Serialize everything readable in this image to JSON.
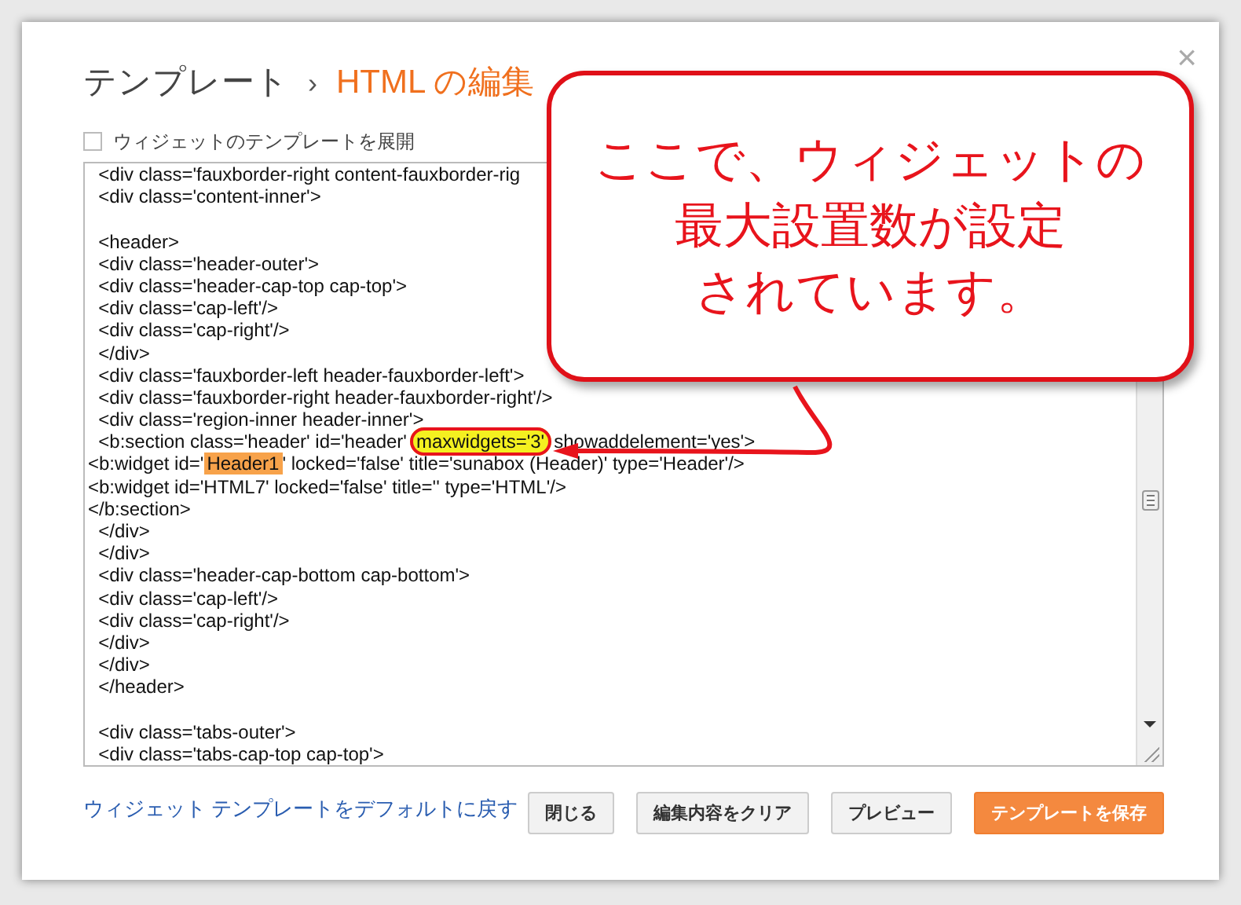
{
  "dialog": {
    "breadcrumb": [
      {
        "label": "テンプレート",
        "current": false
      },
      {
        "label": "HTML の編集",
        "current": true
      }
    ],
    "separator": "›",
    "close": "×",
    "expand_option": {
      "label": "ウィジェットのテンプレートを展開",
      "checked": false
    },
    "code_lines": [
      {
        "segments": [
          {
            "text": "  <div class='fauxborder-right content-fauxborder-rig"
          }
        ]
      },
      {
        "segments": [
          {
            "text": "  <div class='content-inner'>"
          }
        ]
      },
      {
        "kind": "blank"
      },
      {
        "segments": [
          {
            "text": "  <header>"
          }
        ]
      },
      {
        "segments": [
          {
            "text": "  <div class='header-outer'>"
          }
        ]
      },
      {
        "segments": [
          {
            "text": "  <div class='header-cap-top cap-top'>"
          }
        ]
      },
      {
        "segments": [
          {
            "text": "  <div class='cap-left'/>"
          }
        ]
      },
      {
        "segments": [
          {
            "text": "  <div class='cap-right'/>"
          }
        ]
      },
      {
        "segments": [
          {
            "text": "  </div>"
          }
        ]
      },
      {
        "segments": [
          {
            "text": "  <div class='fauxborder-left header-fauxborder-left'>"
          }
        ]
      },
      {
        "segments": [
          {
            "text": "  <div class='fauxborder-right header-fauxborder-right'/>"
          }
        ]
      },
      {
        "segments": [
          {
            "text": "  <div class='region-inner header-inner'>"
          }
        ]
      },
      {
        "segments": [
          {
            "text": "  <b:section class='header' id='header'"
          },
          {
            "text": "maxwidgets='3'",
            "color": "#f4f020",
            "circled": true
          },
          {
            "text": "showaddelement='yes'>"
          }
        ]
      },
      {
        "segments": [
          {
            "text": "<b:widget id='"
          },
          {
            "text": "Header1",
            "color": "#f7a24a"
          },
          {
            "text": "' locked='false' title='sunabox (Header)' type='Header'/>"
          }
        ]
      },
      {
        "segments": [
          {
            "text": "<b:widget id='HTML7' locked='false' title='' type='HTML'/>"
          }
        ]
      },
      {
        "segments": [
          {
            "text": "</b:section>"
          }
        ]
      },
      {
        "segments": [
          {
            "text": "  </div>"
          }
        ]
      },
      {
        "segments": [
          {
            "text": "  </div>"
          }
        ]
      },
      {
        "segments": [
          {
            "text": "  <div class='header-cap-bottom cap-bottom'>"
          }
        ]
      },
      {
        "segments": [
          {
            "text": "  <div class='cap-left'/>"
          }
        ]
      },
      {
        "segments": [
          {
            "text": "  <div class='cap-right'/>"
          }
        ]
      },
      {
        "segments": [
          {
            "text": "  </div>"
          }
        ]
      },
      {
        "segments": [
          {
            "text": "  </div>"
          }
        ]
      },
      {
        "segments": [
          {
            "text": "  </header>"
          }
        ]
      },
      {
        "kind": "blank"
      },
      {
        "segments": [
          {
            "text": "  <div class='tabs-outer'>"
          }
        ]
      },
      {
        "segments": [
          {
            "text": "  <div class='tabs-cap-top cap-top'>"
          }
        ]
      }
    ],
    "reset_link": "ウィジェット テンプレートをデフォルトに戻す",
    "buttons": [
      {
        "label": "閉じる",
        "kind": "plain"
      },
      {
        "label": "編集内容をクリア",
        "kind": "plain"
      },
      {
        "label": "プレビュー",
        "kind": "plain"
      },
      {
        "label": "テンプレートを保存",
        "kind": "primary"
      }
    ]
  },
  "callout": {
    "lines": [
      "ここで、ウィジェットの",
      "最大設置数が設定",
      "されています。"
    ]
  }
}
